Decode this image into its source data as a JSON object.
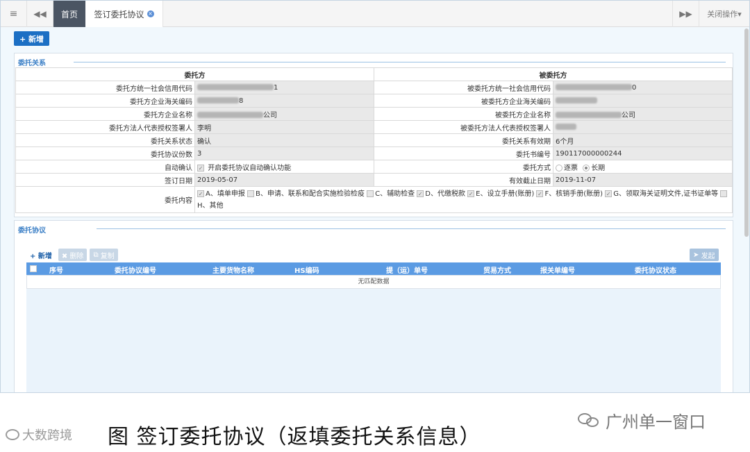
{
  "topbar": {
    "home_tab": "首页",
    "active_tab": "签订委托协议",
    "close_ops": "关闭操作"
  },
  "main": {
    "add_button": "+ 新增"
  },
  "relation_panel": {
    "title": "委托关系",
    "headers": [
      "委托方",
      "被委托方"
    ],
    "rows": [
      {
        "l_label": "委托方统一社会信用代码",
        "l_value": "",
        "l_suffix": "1",
        "r_label": "被委托方统一社会信用代码",
        "r_value": "",
        "r_suffix": "0"
      },
      {
        "l_label": "委托方企业海关编码",
        "l_value": "",
        "l_suffix": "8",
        "r_label": "被委托方企业海关编码",
        "r_value": "",
        "r_suffix": ""
      },
      {
        "l_label": "委托方企业名称",
        "l_value": "",
        "l_suffix": "公司",
        "r_label": "被委托方企业名称",
        "r_value": "",
        "r_suffix": "公司"
      },
      {
        "l_label": "委托方法人代表授权签署人",
        "l_value": "李明",
        "l_suffix": "",
        "r_label": "被委托方法人代表授权签署人",
        "r_value": "",
        "r_suffix": ""
      },
      {
        "l_label": "委托关系状态",
        "l_value": "确认",
        "l_suffix": "",
        "r_label": "委托关系有效期",
        "r_value": "6个月",
        "r_suffix": ""
      },
      {
        "l_label": "委托协议份数",
        "l_value": "3",
        "l_suffix": "",
        "r_label": "委托书编号",
        "r_value": "190117000000244",
        "r_suffix": ""
      }
    ],
    "auto_confirm_label": "自动确认",
    "auto_confirm_text": "开启委托协议自动确认功能",
    "mode_label": "委托方式",
    "mode_options": [
      "逐票",
      "长期"
    ],
    "sign_date_label": "签订日期",
    "sign_date": "2019-05-07",
    "expire_label": "有效截止日期",
    "expire_date": "2019-11-07",
    "content_label": "委托内容",
    "content_items": [
      "A、填单申报",
      "B、申请、联系和配合实施检验检疫",
      "C、辅助检查",
      "D、代缴税款",
      "E、设立手册(账册)",
      "F、核销手册(账册)",
      "G、领取海关证明文件,证书证单等",
      "H、其他"
    ]
  },
  "agreement_panel": {
    "title": "委托协议",
    "buttons": {
      "add": "+ 新增",
      "delete": "✖ 删除",
      "copy": "复制",
      "send": "发起"
    },
    "columns": [
      "序号",
      "委托协议编号",
      "主要货物名称",
      "HS编码",
      "提（运）单号",
      "贸易方式",
      "报关单编号",
      "委托协议状态"
    ],
    "empty_text": "无匹配数据"
  },
  "caption": {
    "left_logo": "大数跨境",
    "text": "图  签订委托协议（返填委托关系信息）",
    "right_logo": "广州单一窗口"
  }
}
